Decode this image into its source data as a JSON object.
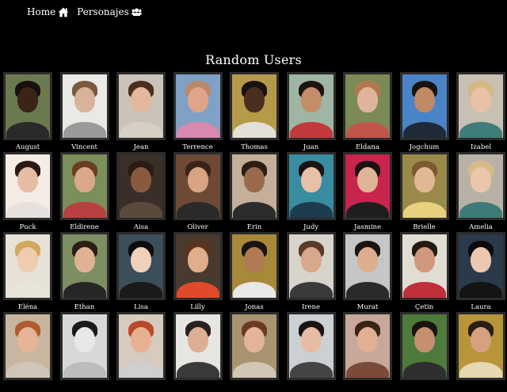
{
  "nav": {
    "home_label": "Home",
    "home_icon": "home-icon",
    "characters_label": "Personajes",
    "characters_icon": "users-icon"
  },
  "title": "Random Users",
  "colors": {
    "background": "#000000",
    "text": "#ffffff",
    "frame": "#2c2c2c"
  },
  "users": [
    {
      "name": "August",
      "bg": "#6b7a4e",
      "skin": "#3a2418",
      "hair": "#161010",
      "shirt": "#2a2a2a"
    },
    {
      "name": "Vincent",
      "bg": "#e9e9e6",
      "skin": "#d8b39a",
      "hair": "#7a5a3c",
      "shirt": "#9a9a9a"
    },
    {
      "name": "Jean",
      "bg": "#c9c3b8",
      "skin": "#e3b89c",
      "hair": "#4a2e1e",
      "shirt": "#d6d0c4"
    },
    {
      "name": "Terrence",
      "bg": "#7fa1c6",
      "skin": "#e0a588",
      "hair": "#b88a6a",
      "shirt": "#d889b0"
    },
    {
      "name": "Thomas",
      "bg": "#b69a4c",
      "skin": "#4a2e20",
      "hair": "#1a120c",
      "shirt": "#e3e0d8"
    },
    {
      "name": "Juan",
      "bg": "#9fb6a4",
      "skin": "#c48d6a",
      "hair": "#1c1410",
      "shirt": "#c23a3c"
    },
    {
      "name": "Eldana",
      "bg": "#7b8a56",
      "skin": "#e0b49a",
      "hair": "#b07a4c",
      "shirt": "#c1554a"
    },
    {
      "name": "Jogchum",
      "bg": "#4b84c6",
      "skin": "#c08a66",
      "hair": "#1a1410",
      "shirt": "#1f2a38"
    },
    {
      "name": "Izabel",
      "bg": "#c8c0b2",
      "skin": "#e9c2a6",
      "hair": "#d4b886",
      "shirt": "#3e7d7a"
    },
    {
      "name": "Puck",
      "bg": "#f3ede6",
      "skin": "#e6bca4",
      "hair": "#2a1814",
      "shirt": "#e6e1dc"
    },
    {
      "name": "Eldirene",
      "bg": "#7a8f5a",
      "skin": "#dca88a",
      "hair": "#6a3e24",
      "shirt": "#b84040"
    },
    {
      "name": "Aisa",
      "bg": "#3a2e28",
      "skin": "#8a5a40",
      "hair": "#2a1c14",
      "shirt": "#5a4a3c"
    },
    {
      "name": "Oliver",
      "bg": "#6e4a36",
      "skin": "#d8a484",
      "hair": "#3a2418",
      "shirt": "#2a2a2a"
    },
    {
      "name": "Erin",
      "bg": "#c4b09a",
      "skin": "#9a6a4c",
      "hair": "#2c1e16",
      "shirt": "#2c2c2c"
    },
    {
      "name": "Judy",
      "bg": "#3a8ca0",
      "skin": "#e8c0a6",
      "hair": "#1a1414",
      "shirt": "#1d3c50"
    },
    {
      "name": "Jasmine",
      "bg": "#c8244c",
      "skin": "#e0b496",
      "hair": "#1c1212",
      "shirt": "#1e1e1e"
    },
    {
      "name": "Brielle",
      "bg": "#9a8a4a",
      "skin": "#e2b894",
      "hair": "#7a5a2e",
      "shirt": "#e8d080"
    },
    {
      "name": "Amelia",
      "bg": "#b8b2a6",
      "skin": "#ecc6aa",
      "hair": "#d6ba88",
      "shirt": "#3e7a78"
    },
    {
      "name": "Eléna",
      "bg": "#e6e2d8",
      "skin": "#efcbb0",
      "hair": "#d2a85a",
      "shirt": "#e8e4da"
    },
    {
      "name": "Ethan",
      "bg": "#7c8e62",
      "skin": "#e0b294",
      "hair": "#2c1e14",
      "shirt": "#262626"
    },
    {
      "name": "Lisa",
      "bg": "#3c4e5a",
      "skin": "#efd0ba",
      "hair": "#0e0c0c",
      "shirt": "#1a1a1a"
    },
    {
      "name": "Lilly",
      "bg": "#4a3a2e",
      "skin": "#e0ae8a",
      "hair": "#5a3420",
      "shirt": "#e04a2a"
    },
    {
      "name": "Jonas",
      "bg": "#a8883a",
      "skin": "#b07a54",
      "hair": "#1a1410",
      "shirt": "#e8e8e8"
    },
    {
      "name": "Irene",
      "bg": "#d8d4cc",
      "skin": "#d8a88a",
      "hair": "#5a3a28",
      "shirt": "#3a3a3a"
    },
    {
      "name": "Murat",
      "bg": "#c4c6c8",
      "skin": "#dcae8e",
      "hair": "#1c1410",
      "shirt": "#2a2a2a"
    },
    {
      "name": "Çetin",
      "bg": "#e2ddd2",
      "skin": "#d0987a",
      "hair": "#241a14",
      "shirt": "#c0303a"
    },
    {
      "name": "Laura",
      "bg": "#2a3a4a",
      "skin": "#ecc8b0",
      "hair": "#0c0a0c",
      "shirt": "#141414"
    },
    {
      "name": "",
      "bg": "#c8b6a0",
      "skin": "#e6b496",
      "hair": "#b05a30",
      "shirt": "#cfc6b8"
    },
    {
      "name": "",
      "bg": "#d8d8d8",
      "skin": "#e8e8e8",
      "hair": "#1a1a1a",
      "shirt": "#bcbcbc"
    },
    {
      "name": "",
      "bg": "#d6cbbe",
      "skin": "#e8b092",
      "hair": "#b84a2a",
      "shirt": "#cfcfcf"
    },
    {
      "name": "",
      "bg": "#e8e6e2",
      "skin": "#dcae92",
      "hair": "#2a2020",
      "shirt": "#3a3a3a"
    },
    {
      "name": "",
      "bg": "#a89470",
      "skin": "#e4b498",
      "hair": "#6a3a24",
      "shirt": "#d2c6b4"
    },
    {
      "name": "",
      "bg": "#cdd0d2",
      "skin": "#e6bca2",
      "hair": "#1a1414",
      "shirt": "#444"
    },
    {
      "name": "",
      "bg": "#c8a898",
      "skin": "#e2b094",
      "hair": "#3a2418",
      "shirt": "#7a4a3a"
    },
    {
      "name": "",
      "bg": "#4e7a3c",
      "skin": "#c4906e",
      "hair": "#1a1410",
      "shirt": "#2e2e2e"
    },
    {
      "name": "",
      "bg": "#b8943a",
      "skin": "#d4a27e",
      "hair": "#2a1e16",
      "shirt": "#e6d8b0"
    }
  ]
}
